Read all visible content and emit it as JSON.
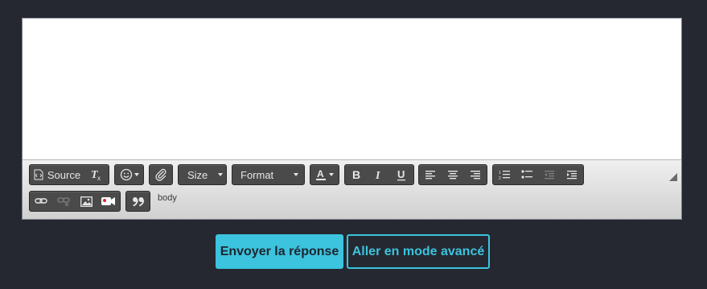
{
  "editor": {
    "toolbar": {
      "source_label": "Source",
      "size_label": "Size",
      "format_label": "Format",
      "icons": [
        "source-icon",
        "remove-format-icon",
        "emoji-icon",
        "attachment-icon",
        "text-color-icon",
        "bold-icon",
        "italic-icon",
        "underline-icon",
        "align-left-icon",
        "align-center-icon",
        "align-right-icon",
        "numbered-list-icon",
        "bulleted-list-icon",
        "outdent-icon",
        "indent-icon",
        "link-icon",
        "unlink-icon",
        "image-icon",
        "video-icon",
        "blockquote-icon",
        "resize-icon"
      ]
    },
    "path_label": "body"
  },
  "actions": {
    "send_label": "Envoyer la réponse",
    "advanced_label": "Aller en mode avancé"
  },
  "colors": {
    "page_bg": "#252830",
    "accent": "#3cc3dd",
    "toolbar_group": "#4a4a4a"
  }
}
